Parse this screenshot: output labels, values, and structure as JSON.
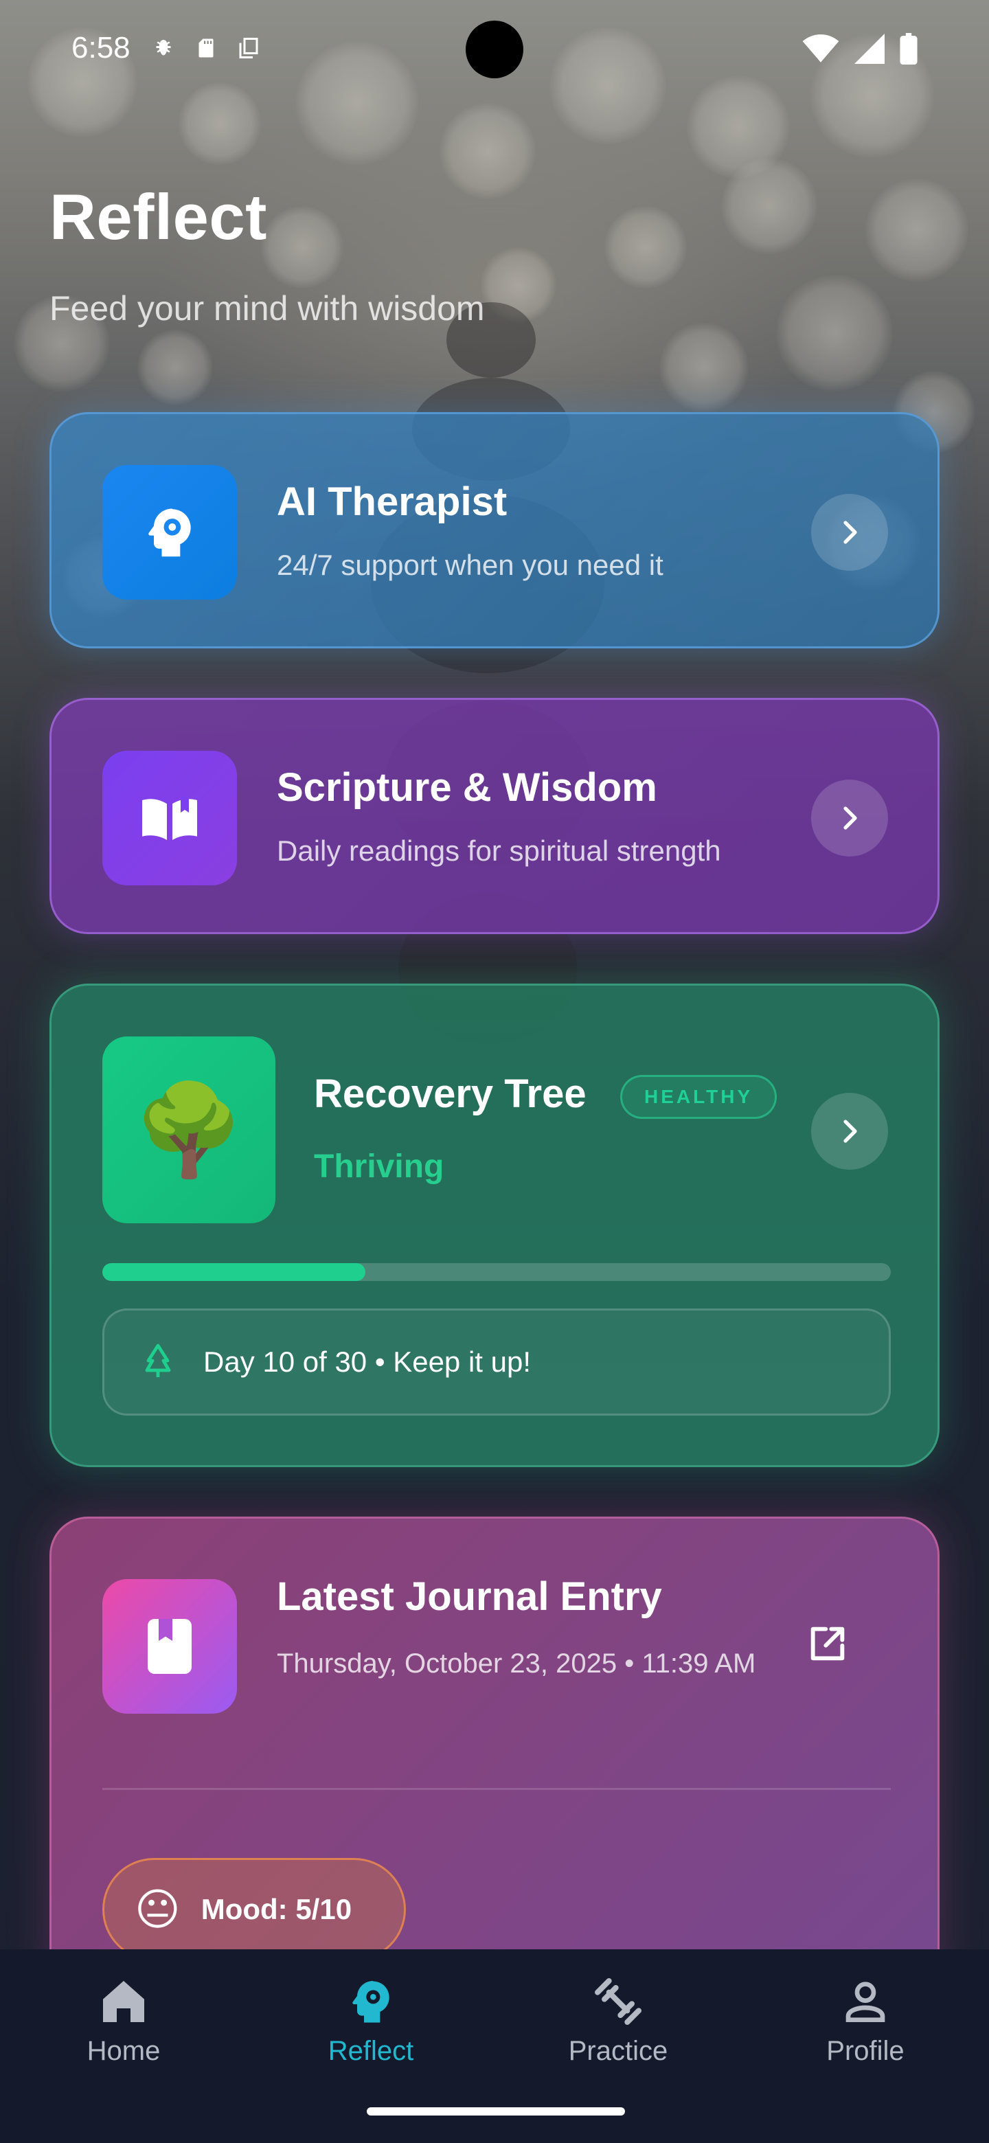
{
  "status_bar": {
    "time": "6:58"
  },
  "header": {
    "title": "Reflect",
    "subtitle": "Feed your mind with wisdom"
  },
  "cards": {
    "ai_therapist": {
      "title": "AI Therapist",
      "subtitle": "24/7 support when you need it",
      "accent": "#1a86f0"
    },
    "scripture": {
      "title": "Scripture & Wisdom",
      "subtitle": "Daily readings for spiritual strength",
      "accent": "#7b3ff0"
    },
    "recovery_tree": {
      "title": "Recovery Tree",
      "badge": "HEALTHY",
      "status": "Thriving",
      "emoji": "🌳",
      "progress_current_day": 10,
      "progress_total_days": 30,
      "progress_text": "Day 10 of 30 • Keep it up!",
      "accent": "#1fcf8d"
    },
    "journal": {
      "title": "Latest Journal Entry",
      "date": "Thursday, October 23, 2025 • 11:39 AM",
      "mood_emoji": "😐",
      "mood_text": "Mood: 5/10"
    }
  },
  "bottom_nav": {
    "items": [
      {
        "label": "Home",
        "icon": "home-icon"
      },
      {
        "label": "Reflect",
        "icon": "head-gear-icon"
      },
      {
        "label": "Practice",
        "icon": "dumbbell-icon"
      },
      {
        "label": "Profile",
        "icon": "person-icon"
      }
    ],
    "active_index": 1,
    "active_color": "#22b8cf"
  }
}
